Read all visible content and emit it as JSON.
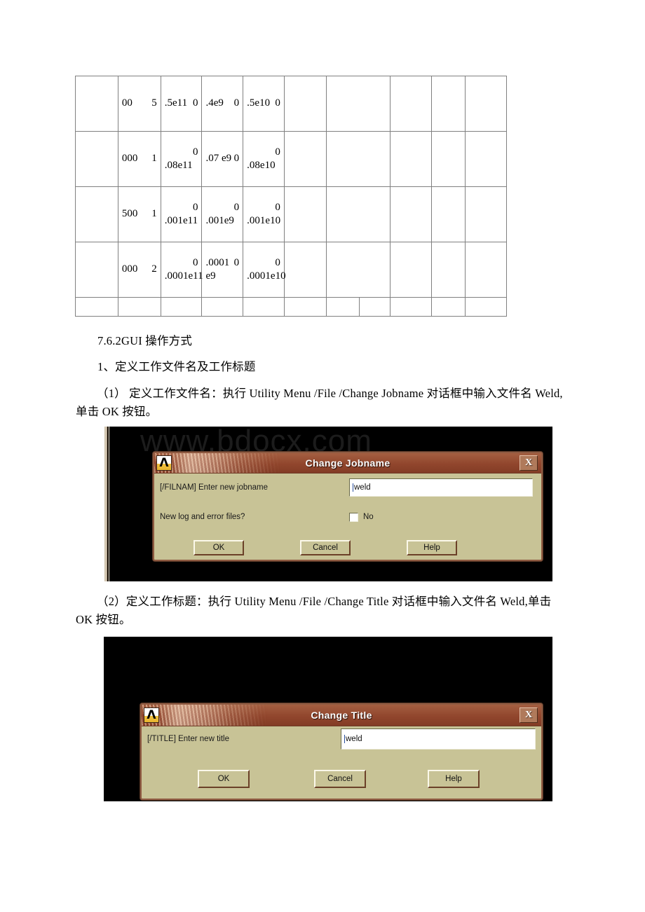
{
  "document": {
    "watermark": "www.bdocx.com"
  },
  "table": {
    "rows": [
      {
        "c1": "",
        "c2": {
          "lead": "5",
          "num": "00"
        },
        "c3": {
          "lead": "0",
          "num": ".5e11"
        },
        "c4": {
          "lead": "0",
          "num": ".4e9"
        },
        "c5": {
          "lead": "0",
          "num": ".5e10"
        }
      },
      {
        "c1": "",
        "c2": {
          "lead": "1",
          "num": "000"
        },
        "c3": {
          "lead": "0",
          "num": ".08e11"
        },
        "c4": {
          "lead": "0",
          "num": ".07 e9"
        },
        "c5": {
          "lead": "0",
          "num": ".08e10"
        }
      },
      {
        "c1": "",
        "c2": {
          "lead": "1",
          "num": "500"
        },
        "c3": {
          "lead": "0",
          "num": ".001e11"
        },
        "c4": {
          "lead": "0",
          "num": ".001e9"
        },
        "c5": {
          "lead": "0",
          "num": ".001e10"
        }
      },
      {
        "c1": "",
        "c2": {
          "lead": "2",
          "num": "000"
        },
        "c3": {
          "lead": "0",
          "num": ".0001e11"
        },
        "c4": {
          "lead": "0",
          "num": ".0001 e9"
        },
        "c5": {
          "lead": "0",
          "num": ".0001e10"
        }
      }
    ],
    "spacer_row_cells": [
      "",
      "",
      "",
      "",
      "",
      "",
      "",
      "",
      "",
      "",
      ""
    ]
  },
  "body": {
    "heading": "7.6.2GUI 操作方式",
    "item1": "1、定义工作文件名及工作标题",
    "sub1": "（1） 定义工作文件名：执行 Utility Menu /File /Change Jobname 对话框中输入文件名 Weld,单击 OK 按钮。",
    "sub2": "（2）定义工作标题：执行 Utility Menu /File /Change Title 对话框中输入文件名 Weld,单击 OK 按钮。"
  },
  "dialog_jobname": {
    "logo_glyph": "Λ",
    "title": "Change Jobname",
    "close_label": "X",
    "field_label": "[/FILNAM] Enter new jobname",
    "field_value": "weld",
    "field_placeholder": "Enter new jobname",
    "checkbox_label": "New log and error files?",
    "checkbox_option": "No",
    "checkbox_checked": false,
    "buttons": [
      "OK",
      "Cancel",
      "Help"
    ]
  },
  "dialog_title": {
    "logo_glyph": "Λ",
    "title": "Change Title",
    "close_label": "X",
    "field_label": "[/TITLE]  Enter new title",
    "field_value": "weld",
    "field_placeholder": "Enter new title",
    "buttons": [
      "OK",
      "Cancel",
      "Help"
    ]
  },
  "colors": {
    "dialog_face": "#c8c396",
    "titlebar_brown": "#91462d",
    "dialog_border": "#8f5b42",
    "button_shadow": "#6b4028",
    "table_border": "#808080",
    "screenshot_background": "#000000",
    "caret_blue": "#2b4f9e"
  }
}
